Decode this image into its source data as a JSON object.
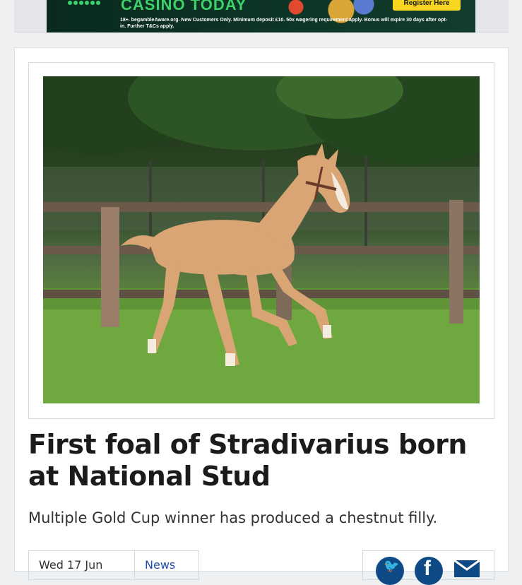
{
  "ad": {
    "headline": "CASINO TODAY",
    "cta": "Register Here",
    "terms": "18+. begambleAware.org. New Customers Only. Minimum deposit £10. 50x wagering requirement apply. Bonus will expire 30 days after opt-in. Further T&Cs apply."
  },
  "article": {
    "image_alt": "Chestnut foal cantering across a paddock",
    "headline": "First foal of Stradivarius born at National Stud",
    "standfirst": "Multiple Gold Cup winner has produced a chestnut filly.",
    "date": "Wed 17 Jun",
    "category": "News"
  },
  "share": {
    "twitter_icon": "twitter-icon",
    "facebook_icon": "facebook-icon",
    "email_icon": "email-icon"
  },
  "colors": {
    "accent": "#0d4a86",
    "ad_green": "#3cd26b",
    "ad_cta": "#f8d51e"
  }
}
